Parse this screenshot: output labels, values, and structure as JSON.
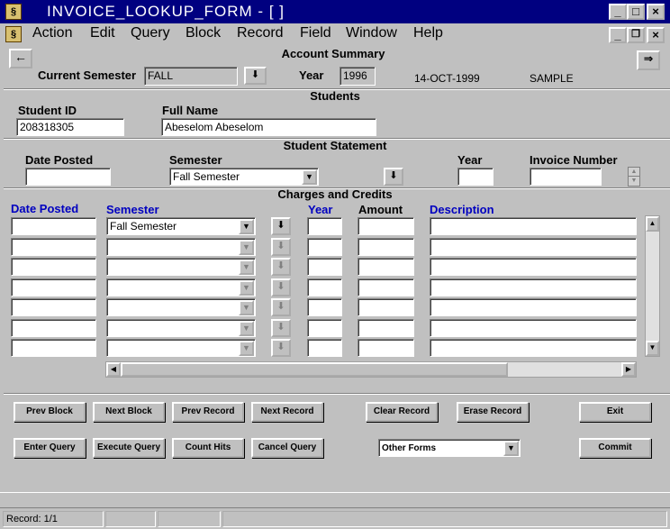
{
  "window": {
    "title": "INVOICE_LOOKUP_FORM - [ ]"
  },
  "menu": [
    "Action",
    "Edit",
    "Query",
    "Block",
    "Record",
    "Field",
    "Window",
    "Help"
  ],
  "account_summary": {
    "heading": "Account Summary",
    "current_semester_label": "Current Semester",
    "current_semester_value": "FALL",
    "year_label": "Year",
    "year_value": "1996",
    "date": "14-OCT-1999",
    "user": "SAMPLE"
  },
  "students": {
    "heading": "Students",
    "student_id_label": "Student ID",
    "student_id_value": "208318305",
    "full_name_label": "Full Name",
    "full_name_value": "Abeselom  Abeselom"
  },
  "statement": {
    "heading": "Student Statement",
    "date_posted_label": "Date Posted",
    "date_posted_value": "",
    "semester_label": "Semester",
    "semester_value": "Fall Semester",
    "year_label": "Year",
    "year_value": "",
    "invoice_label": "Invoice Number",
    "invoice_value": ""
  },
  "charges": {
    "heading": "Charges and Credits",
    "columns": {
      "date_posted": "Date Posted",
      "semester": "Semester",
      "year": "Year",
      "amount": "Amount",
      "description": "Description"
    },
    "rows": [
      {
        "date_posted": "",
        "semester": "Fall Semester",
        "year": "",
        "amount": "",
        "description": ""
      },
      {
        "date_posted": "",
        "semester": "",
        "year": "",
        "amount": "",
        "description": ""
      },
      {
        "date_posted": "",
        "semester": "",
        "year": "",
        "amount": "",
        "description": ""
      },
      {
        "date_posted": "",
        "semester": "",
        "year": "",
        "amount": "",
        "description": ""
      },
      {
        "date_posted": "",
        "semester": "",
        "year": "",
        "amount": "",
        "description": ""
      },
      {
        "date_posted": "",
        "semester": "",
        "year": "",
        "amount": "",
        "description": ""
      },
      {
        "date_posted": "",
        "semester": "",
        "year": "",
        "amount": "",
        "description": ""
      }
    ]
  },
  "buttons": {
    "prev_block": "Prev Block",
    "next_block": "Next Block",
    "prev_record": "Prev Record",
    "next_record": "Next Record",
    "clear_record": "Clear Record",
    "erase_record": "Erase Record",
    "exit": "Exit",
    "enter_query": "Enter Query",
    "execute_query": "Execute Query",
    "count_hits": "Count Hits",
    "cancel_query": "Cancel Query",
    "other_forms": "Other Forms",
    "commit": "Commit"
  },
  "status": {
    "record": "Record: 1/1"
  }
}
